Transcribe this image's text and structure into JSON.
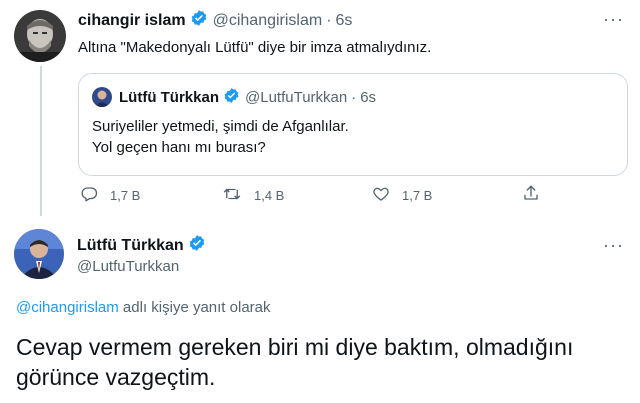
{
  "colors": {
    "accent": "#1d9bf0",
    "muted": "#536471",
    "border": "#cfd9de"
  },
  "tweet1": {
    "name": "cihangir islam",
    "handle": "@cihangirislam",
    "time": "6s",
    "text": "Altına \"Makedonyalı Lütfü\" diye bir imza atmalıydınız.",
    "verified_icon": "verified-badge-icon",
    "more_icon": "more-options-icon"
  },
  "quote": {
    "name": "Lütfü Türkkan",
    "handle": "@LutfuTurkkan",
    "time": "6s",
    "line1": "Suriyeliler yetmedi, şimdi de Afganlılar.",
    "line2": "Yol geçen hanı mı burası?"
  },
  "actions": {
    "reply": {
      "icon": "reply-icon",
      "count": "1,7 B"
    },
    "retweet": {
      "icon": "retweet-icon",
      "count": "1,4 B"
    },
    "like": {
      "icon": "heart-icon",
      "count": "1,7 B"
    },
    "share": {
      "icon": "share-icon"
    }
  },
  "tweet2": {
    "name": "Lütfü Türkkan",
    "handle": "@LutfuTurkkan",
    "reply_mention": "@cihangirislam",
    "reply_suffix": " adlı kişiye yanıt olarak",
    "text": "Cevap vermem gereken biri mi diye baktım, olmadığını görünce vazgeçtim."
  }
}
